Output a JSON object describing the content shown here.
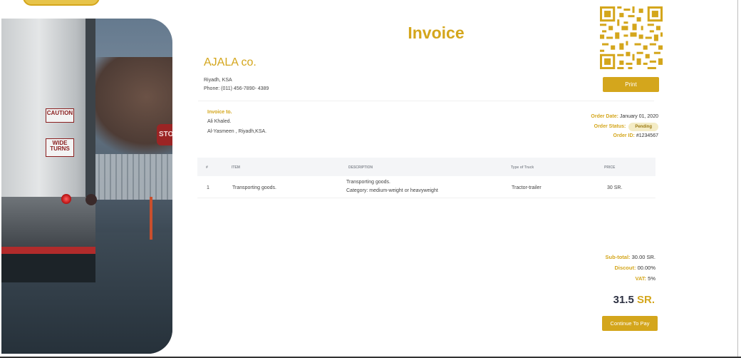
{
  "brand_color": "#d4a61c",
  "invoice": {
    "title": "Invoice",
    "company": {
      "name": "AJALA co.",
      "address": "Riyadh, KSA",
      "phone": "Phone: (011) 456-7890- 4389"
    },
    "print_label": "Print",
    "bill_to": {
      "label": "Invoice to.",
      "name": "Ali Khaled.",
      "address": "Al-Yasmeen , Riyadh,KSA."
    },
    "order": {
      "date_label": "Order Date:",
      "date_value": "January 01, 2020",
      "status_label": "Order Status:",
      "status_value": "Pending",
      "id_label": "Order ID:",
      "id_value": "#1234567"
    },
    "table": {
      "headers": {
        "num": "#",
        "item": "ITEM",
        "description": "DESCRIPTION",
        "truck": "Type of Truck",
        "price": "PRICE"
      },
      "rows": [
        {
          "num": "1",
          "item": "Transporting goods.",
          "description_line1": "Transporting goods.",
          "description_line2": "Category: medium-weight or heavyweight",
          "truck": "Tractor-trailer",
          "price": "30 SR."
        }
      ]
    },
    "totals": {
      "subtotal_label": "Sub-total:",
      "subtotal_value": "30.00 SR.",
      "discount_label": "Discout:",
      "discount_value": "00.00%",
      "vat_label": "VAT:",
      "vat_value": "5%"
    },
    "grand_total": {
      "amount": "31.5",
      "currency": "SR."
    },
    "pay_label": "Continue To Pay"
  },
  "hero": {
    "sign_caution": "CAUTION",
    "sign_wide": "WIDE TURNS",
    "sign_stop": "STO"
  },
  "icons": {
    "qr": "qr-code-icon"
  }
}
